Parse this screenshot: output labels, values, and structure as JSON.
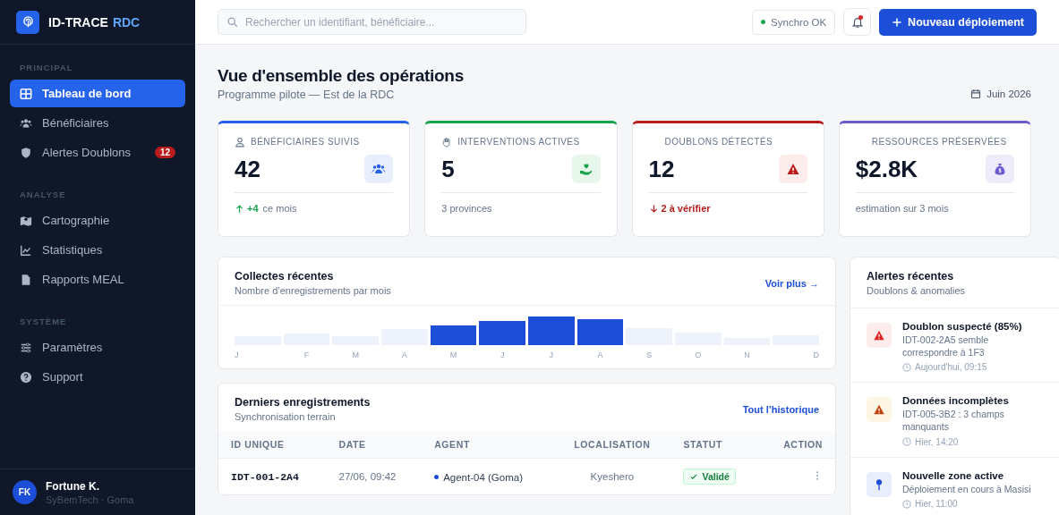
{
  "brand": {
    "name": "ID-TRACE",
    "suffix": "RDC"
  },
  "nav": [
    {
      "heading": "PRINCIPAL",
      "items": [
        {
          "label": "Tableau de bord",
          "selected": true
        },
        {
          "label": "Bénéficiaires",
          "selected": false
        },
        {
          "label": "Alertes Doublons",
          "selected": false,
          "badge": "12"
        }
      ]
    },
    {
      "heading": "ANALYSE",
      "items": [
        {
          "label": "Cartographie",
          "selected": false
        },
        {
          "label": "Statistiques",
          "selected": false
        },
        {
          "label": "Rapports MEAL",
          "selected": false
        }
      ]
    },
    {
      "heading": "SYSTÈME",
      "items": [
        {
          "label": "Paramètres",
          "selected": false
        },
        {
          "label": "Support",
          "selected": false
        }
      ]
    }
  ],
  "user": {
    "initials": "FK",
    "name": "Fortune K.",
    "org": "SyBemTech · Goma"
  },
  "search": {
    "placeholder": "Rechercher un identifiant, bénéficiaire..."
  },
  "sync": {
    "label": "Synchro OK",
    "ok": true
  },
  "notifications": {
    "unread": true
  },
  "primary_button": "Nouveau déploiement",
  "page": {
    "title": "Vue d'ensemble des opérations",
    "subtitle": "Programme pilote — Est de la RDC",
    "period": "Juin 2026"
  },
  "stats": [
    {
      "label": "BÉNÉFICIAIRES SUIVIS",
      "value": "42",
      "color": "#2563eb",
      "kind": "up",
      "delta": "+4",
      "note": "ce mois"
    },
    {
      "label": "INTERVENTIONS ACTIVES",
      "value": "5",
      "color": "#16a34a",
      "kind": "plain",
      "note": "3 provinces"
    },
    {
      "label": "DOUBLONS DÉTECTÉS",
      "value": "12",
      "color": "#b91c1c",
      "kind": "down",
      "delta": "2 à vérifier"
    },
    {
      "label": "RESSOURCES PRÉSERVÉES",
      "value": "$2.8K",
      "color": "#6d5bd0",
      "kind": "plain",
      "note": "estimation sur 3 mois"
    }
  ],
  "collections": {
    "title": "Collectes récentes",
    "subtitle": "Nombre d’enregistrements par mois",
    "link": "Voir plus →",
    "months": [
      {
        "label": "J",
        "active": false
      },
      {
        "label": "F",
        "active": false
      },
      {
        "label": "M",
        "active": false
      },
      {
        "label": "A",
        "active": false
      },
      {
        "label": "M",
        "active": true
      },
      {
        "label": "J",
        "active": true
      },
      {
        "label": "J",
        "active": true
      },
      {
        "label": "A",
        "active": true
      },
      {
        "label": "S",
        "active": false
      },
      {
        "label": "O",
        "active": false
      },
      {
        "label": "N",
        "active": false
      },
      {
        "label": "D",
        "active": false
      }
    ]
  },
  "records": {
    "title": "Derniers enregistrements",
    "subtitle": "Synchronisation terrain",
    "link": "Tout l’historique",
    "columns": [
      "ID UNIQUE",
      "DATE",
      "AGENT",
      "LOCALISATION",
      "STATUT",
      "ACTION"
    ],
    "rows": [
      {
        "id": "IDT-001-2A4",
        "date": "27/06, 09:42",
        "agent": "Agent-04 (Goma)",
        "location": "Kyeshero",
        "status": "Validé",
        "kind": "ok"
      }
    ]
  },
  "alerts": {
    "title": "Alertes récentes",
    "subtitle": "Doublons & anomalies",
    "items": [
      {
        "title": "Doublon suspecté (85%)",
        "text": "IDT-002-2A5 semble correspondre à 1F3",
        "time": "Aujourd'hui, 09:15",
        "color": "#dc2626"
      },
      {
        "title": "Données incomplètes",
        "text": "IDT-005-3B2 : 3 champs manquants",
        "time": "Hier, 14:20",
        "color": "#c2410c"
      },
      {
        "title": "Nouvelle zone active",
        "text": "Déploiement en cours à Masisi",
        "time": "Hier, 11:00",
        "color": "#1d4ed8"
      }
    ]
  }
}
